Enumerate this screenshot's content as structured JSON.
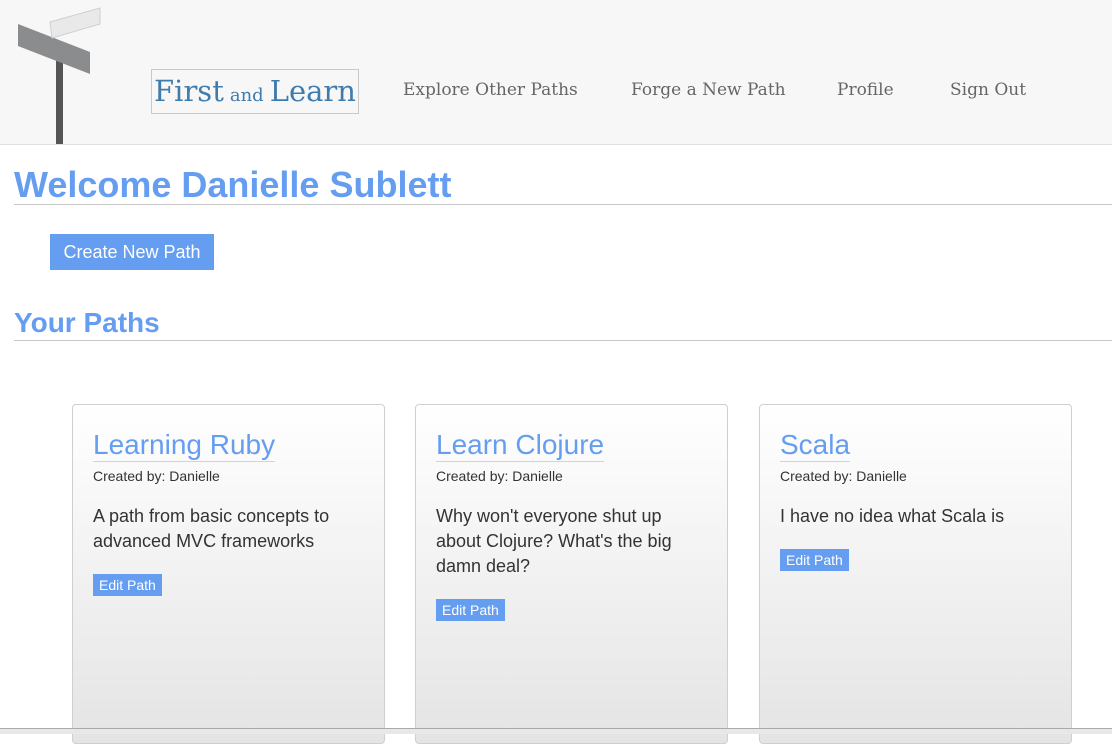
{
  "nav": {
    "brand_first": "First",
    "brand_and": "and",
    "brand_learn": "Learn",
    "links": [
      "Explore Other Paths",
      "Forge a New Path",
      "Profile",
      "Sign Out"
    ]
  },
  "welcome": "Welcome Danielle Sublett",
  "create_button": "Create New Path",
  "paths_heading": "Your Paths",
  "paths": [
    {
      "title": "Learning Ruby",
      "author": "Created by: Danielle",
      "description": "A path from basic concepts to advanced MVC frameworks",
      "edit_label": "Edit Path"
    },
    {
      "title": "Learn Clojure",
      "author": "Created by: Danielle",
      "description": "Why won't everyone shut up about Clojure? What's the big damn deal?",
      "edit_label": "Edit Path"
    },
    {
      "title": "Scala",
      "author": "Created by: Danielle",
      "description": "I have no idea what Scala is",
      "edit_label": "Edit Path"
    }
  ],
  "colors": {
    "accent": "#659df0",
    "brand": "#3f7cae",
    "nav_bg": "#f7f7f7"
  },
  "icons": [
    "signpost-icon"
  ]
}
